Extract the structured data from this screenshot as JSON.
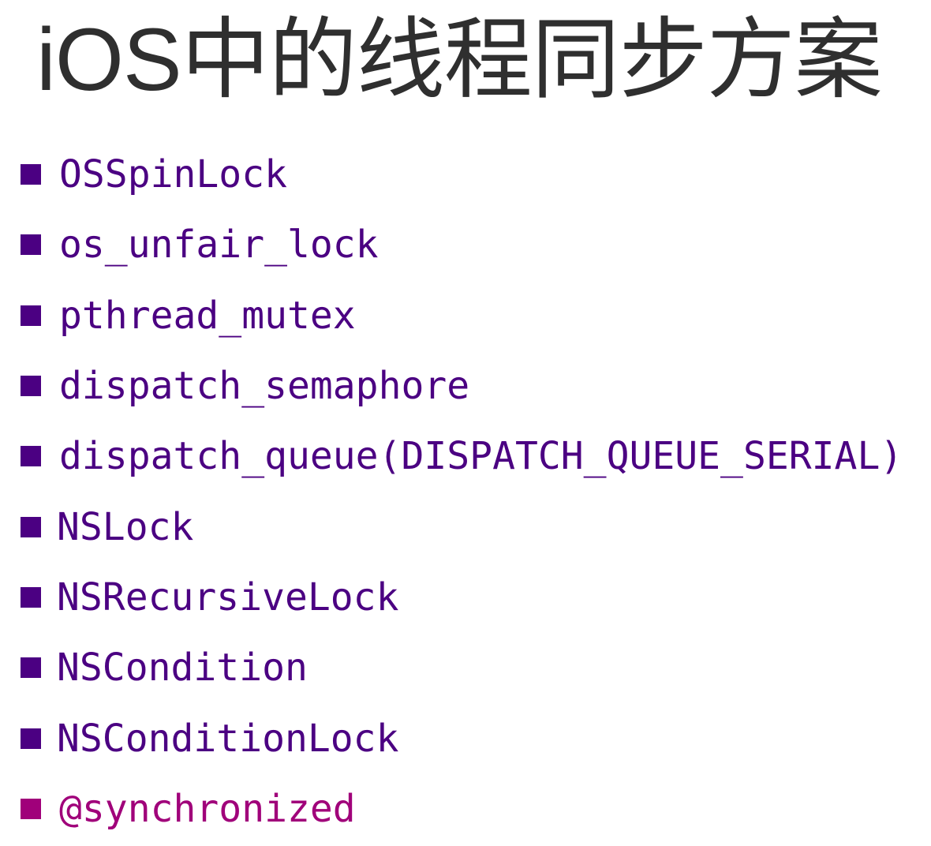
{
  "slide": {
    "title": "iOS中的线程同步方案"
  },
  "colors": {
    "title": "#2f2f2f",
    "item": "#4b0082",
    "highlight": "#a0007a"
  },
  "items": [
    {
      "label": "OSSpinLock",
      "highlight": false
    },
    {
      "label": "os_unfair_lock",
      "highlight": false
    },
    {
      "label": "pthread_mutex",
      "highlight": false
    },
    {
      "label": "dispatch_semaphore",
      "highlight": false
    },
    {
      "label": "dispatch_queue(DISPATCH_QUEUE_SERIAL)",
      "highlight": false
    },
    {
      "label": "NSLock",
      "highlight": false
    },
    {
      "label": "NSRecursiveLock",
      "highlight": false
    },
    {
      "label": "NSCondition",
      "highlight": false
    },
    {
      "label": "NSConditionLock",
      "highlight": false
    },
    {
      "label": "@synchronized",
      "highlight": true
    }
  ]
}
